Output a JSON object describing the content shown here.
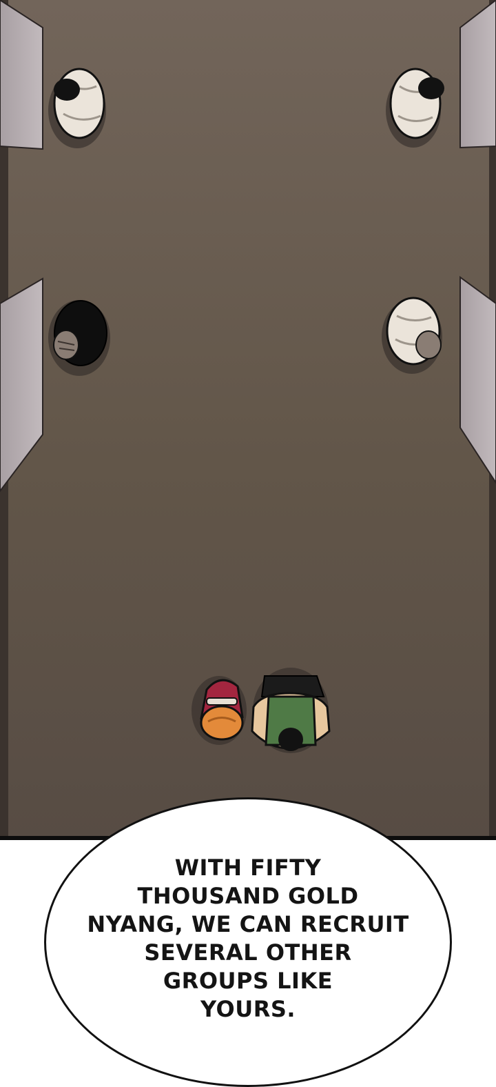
{
  "panel": {
    "description_icons": [
      "top-left-guard",
      "top-right-guard",
      "mid-left-guard",
      "mid-right-guard",
      "girl-figure",
      "warrior-figure"
    ],
    "colors": {
      "floor_top": "#6f6256",
      "floor_bottom": "#5a4f47",
      "wall": "#b6aeb0",
      "robe": "#ebe4da",
      "outline": "#111111"
    }
  },
  "speech": {
    "lines": [
      "WITH FIFTY",
      "THOUSAND GOLD",
      "NYANG, WE CAN RECRUIT",
      "SEVERAL OTHER",
      "GROUPS LIKE",
      "YOURS."
    ]
  }
}
